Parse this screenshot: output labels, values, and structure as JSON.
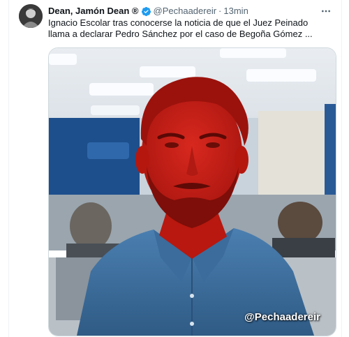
{
  "post": {
    "author_name": "Dean, Jamón Dean ®",
    "author_handle": "@Pechaadereir",
    "separator": "·",
    "time": "13min",
    "text": "Ignacio Escolar tras conocerse la noticia de que el Juez Peinado llama a declarar Pedro Sánchez por el caso de Begoña Gómez ...",
    "media_watermark": "@Pechaadereir"
  },
  "colors": {
    "verified": "#1d9bf0",
    "muted": "#536471",
    "text": "#0f1419",
    "red_tint": "#d0201a",
    "shirt": "#3f6f9e"
  },
  "icons": {
    "verified": "verified-badge-icon",
    "more": "more-options-icon"
  }
}
